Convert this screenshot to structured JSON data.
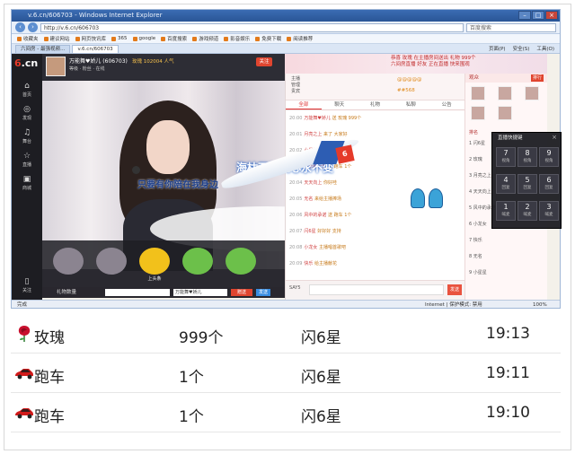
{
  "browser": {
    "title": "v.6.cn/606703 - Windows Internet Explorer",
    "address": "http://v.6.cn/606703",
    "search_placeholder": "百度搜索",
    "favorites": [
      "收藏夹",
      "建议网站",
      "网页快讯库",
      "365",
      "google",
      "百度搜索",
      "游戏频道",
      "影音娱乐",
      "免费下载",
      "阅读推荐"
    ],
    "tabs": [
      "六间房 - 最强视频…",
      "v.6.cn/606703"
    ],
    "tools": [
      "页面(P)",
      "安全(S)",
      "工具(O)"
    ],
    "status": "完成",
    "status_right": "Internet | 保护模式: 禁用",
    "zoom": "100%"
  },
  "site": {
    "logo_num": "6",
    "logo_text": ".cn",
    "nav": [
      "首页",
      "发现",
      "舞台",
      "直播",
      "商城",
      "关注"
    ],
    "banner_news": [
      "恭喜 玫瑰 在主播房间送出 礼物 999个",
      "六间房直播 好友 正在直播 快来围观"
    ]
  },
  "room": {
    "anchor_name": "万能舞♥娇儿 (606703)",
    "meta": "等级 · 粉丝 · 在线",
    "fans_label": "玫瑰 102004 人气",
    "follow_label": "关注",
    "overlay_text": "海枯石烂真心永不变",
    "gift_slots": [
      "",
      "",
      "上头条",
      "",
      ""
    ],
    "input_label": "礼物数量",
    "input2": "万能舞♥娇儿",
    "send_label": "赠送",
    "send2_label": "发送"
  },
  "chat": {
    "top_lines": [
      "主播",
      "管理",
      "贵宾"
    ],
    "gold_1": "@@@@@",
    "gold_2": "##568",
    "tabs": [
      "全部",
      "聊天",
      "礼物",
      "私聊",
      "公告"
    ],
    "lines": [
      {
        "time": "20:00",
        "user": "万能舞♥娇儿",
        "text": "送 玫瑰 999个"
      },
      {
        "time": "20:01",
        "user": "月亮之上",
        "text": "来了 大家好"
      },
      {
        "time": "20:02",
        "user": "小星星",
        "text": "主播好漂亮"
      },
      {
        "time": "20:03",
        "user": "快乐每一天",
        "text": "送 跑车 1个"
      },
      {
        "time": "20:04",
        "user": "天天向上",
        "text": "你好哇"
      },
      {
        "time": "20:05",
        "user": "无名",
        "text": "来给主播捧场"
      },
      {
        "time": "20:06",
        "user": "风中的承诺",
        "text": "送 跑车 1个"
      },
      {
        "time": "20:07",
        "user": "闪6星",
        "text": "好好好 支持"
      },
      {
        "time": "20:08",
        "user": "小龙女",
        "text": "主播唱首歌吧"
      },
      {
        "time": "20:09",
        "user": "快乐",
        "text": "给主播献花"
      }
    ],
    "ad_text": "只要有你陪在我身边",
    "input_select": "SAY5",
    "send_label": "发送"
  },
  "rightcol": {
    "header": "观众",
    "header_btn": "排行",
    "section": "排名",
    "ranks": [
      "1 闪6星",
      "2 玫瑰",
      "3 月亮之上",
      "4 天天向上",
      "5 风中的承诺",
      "6 小龙女",
      "7 快乐",
      "8 无名",
      "9 小星星"
    ]
  },
  "popup": {
    "title": "直播快捷键",
    "close": "×",
    "keys": [
      {
        "n": "7",
        "s": "视角"
      },
      {
        "n": "8",
        "s": "视角"
      },
      {
        "n": "9",
        "s": "视角"
      },
      {
        "n": "4",
        "s": "回复"
      },
      {
        "n": "5",
        "s": "回复"
      },
      {
        "n": "6",
        "s": "回复"
      },
      {
        "n": "1",
        "s": "喊麦"
      },
      {
        "n": "2",
        "s": "喊麦"
      },
      {
        "n": "3",
        "s": "喊麦"
      }
    ]
  },
  "gift_list": [
    {
      "icon": "rose-icon",
      "name": "玫瑰",
      "qty": "999个",
      "sender": "闪6星",
      "time": "19:13"
    },
    {
      "icon": "sports-car-icon",
      "name": "跑车",
      "qty": "1个",
      "sender": "闪6星",
      "time": "19:11"
    },
    {
      "icon": "sports-car-icon",
      "name": "跑车",
      "qty": "1个",
      "sender": "闪6星",
      "time": "19:10"
    }
  ],
  "colors": {
    "accent": "#e0452f",
    "rose": "#c8102e",
    "car": "#d11a1a"
  }
}
